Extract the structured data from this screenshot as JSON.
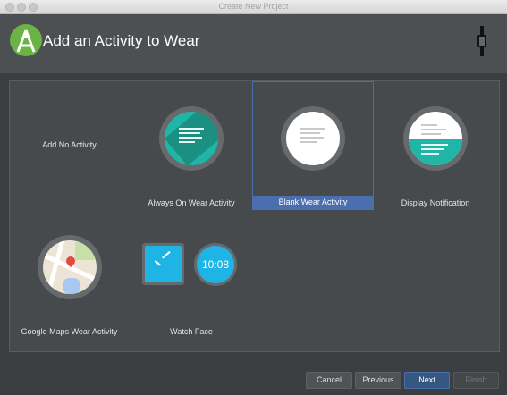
{
  "window": {
    "title": "Create New Project"
  },
  "header": {
    "title": "Add an Activity to Wear"
  },
  "tiles": [
    {
      "label": "Add No Activity"
    },
    {
      "label": "Always On Wear Activity"
    },
    {
      "label": "Blank Wear Activity"
    },
    {
      "label": "Display Notification"
    },
    {
      "label": "Google Maps Wear Activity"
    },
    {
      "label": "Watch Face"
    }
  ],
  "watch_face": {
    "digital_time": "10:08"
  },
  "buttons": {
    "cancel": "Cancel",
    "previous": "Previous",
    "next": "Next",
    "finish": "Finish"
  },
  "colors": {
    "accent": "#4b6eaf",
    "teal": "#20b5a6",
    "watch_blue": "#1eb4e6"
  }
}
